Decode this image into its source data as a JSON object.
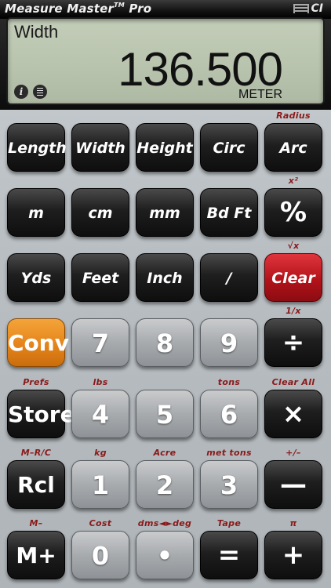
{
  "app": {
    "title_main": "Measure Master",
    "title_tm": "TM",
    "title_suffix": "Pro",
    "logo_text": "CI"
  },
  "display": {
    "label": "Width",
    "value": "136.500",
    "unit": "METER",
    "icons": [
      "info-icon",
      "tape-record-icon"
    ]
  },
  "colors": {
    "lcd_bg": "#b8c3ad",
    "secondary_label": "#8a1a1a",
    "clear_key": "#b3121a",
    "conv_key": "#e5841a"
  },
  "keys": [
    {
      "row": 0,
      "col": 0,
      "label": "Length",
      "style": "dark",
      "type": "it"
    },
    {
      "row": 0,
      "col": 1,
      "label": "Width",
      "style": "dark",
      "type": "it"
    },
    {
      "row": 0,
      "col": 2,
      "label": "Height",
      "style": "dark",
      "type": "it"
    },
    {
      "row": 0,
      "col": 3,
      "label": "Circ",
      "style": "dark",
      "type": "it"
    },
    {
      "row": 0,
      "col": 4,
      "label": "Arc",
      "style": "dark",
      "type": "it",
      "secondary": "Radius"
    },
    {
      "row": 1,
      "col": 0,
      "label": "m",
      "style": "dark",
      "type": "it"
    },
    {
      "row": 1,
      "col": 1,
      "label": "cm",
      "style": "dark",
      "type": "it"
    },
    {
      "row": 1,
      "col": 2,
      "label": "mm",
      "style": "dark",
      "type": "it"
    },
    {
      "row": 1,
      "col": 3,
      "label": "Bd Ft",
      "style": "dark",
      "type": "it"
    },
    {
      "row": 1,
      "col": 4,
      "label": "%",
      "style": "dark",
      "type": "op",
      "secondary": "x²"
    },
    {
      "row": 2,
      "col": 0,
      "label": "Yds",
      "style": "dark",
      "type": "it"
    },
    {
      "row": 2,
      "col": 1,
      "label": "Feet",
      "style": "dark",
      "type": "it"
    },
    {
      "row": 2,
      "col": 2,
      "label": "Inch",
      "style": "dark",
      "type": "it"
    },
    {
      "row": 2,
      "col": 3,
      "label": "/",
      "style": "dark",
      "type": "it"
    },
    {
      "row": 2,
      "col": 4,
      "label": "Clear",
      "style": "red",
      "type": "it",
      "secondary": "√x"
    },
    {
      "row": 3,
      "col": 0,
      "label": "Conv",
      "style": "orange",
      "type": "big"
    },
    {
      "row": 3,
      "col": 1,
      "label": "7",
      "style": "gray",
      "type": "num"
    },
    {
      "row": 3,
      "col": 2,
      "label": "8",
      "style": "gray",
      "type": "num"
    },
    {
      "row": 3,
      "col": 3,
      "label": "9",
      "style": "gray",
      "type": "num"
    },
    {
      "row": 3,
      "col": 4,
      "label": "÷",
      "style": "dark",
      "type": "op",
      "secondary": "1/x"
    },
    {
      "row": 4,
      "col": 0,
      "label": "Store",
      "style": "dark",
      "type": "big",
      "secondary": "Prefs"
    },
    {
      "row": 4,
      "col": 1,
      "label": "4",
      "style": "gray",
      "type": "num",
      "secondary": "lbs"
    },
    {
      "row": 4,
      "col": 2,
      "label": "5",
      "style": "gray",
      "type": "num"
    },
    {
      "row": 4,
      "col": 3,
      "label": "6",
      "style": "gray",
      "type": "num",
      "secondary": "tons"
    },
    {
      "row": 4,
      "col": 4,
      "label": "×",
      "style": "dark",
      "type": "op",
      "secondary": "Clear All"
    },
    {
      "row": 5,
      "col": 0,
      "label": "Rcl",
      "style": "dark",
      "type": "big",
      "secondary": "M–R/C"
    },
    {
      "row": 5,
      "col": 1,
      "label": "1",
      "style": "gray",
      "type": "num",
      "secondary": "kg"
    },
    {
      "row": 5,
      "col": 2,
      "label": "2",
      "style": "gray",
      "type": "num",
      "secondary": "Acre"
    },
    {
      "row": 5,
      "col": 3,
      "label": "3",
      "style": "gray",
      "type": "num",
      "secondary": "met tons"
    },
    {
      "row": 5,
      "col": 4,
      "label": "—",
      "style": "dark",
      "type": "op",
      "secondary": "+/–"
    },
    {
      "row": 6,
      "col": 0,
      "label": "M+",
      "style": "dark",
      "type": "big",
      "secondary": "M–"
    },
    {
      "row": 6,
      "col": 1,
      "label": "0",
      "style": "gray",
      "type": "num",
      "secondary": "Cost"
    },
    {
      "row": 6,
      "col": 2,
      "label": "•",
      "style": "gray",
      "type": "num",
      "secondary": "dms◄►deg"
    },
    {
      "row": 6,
      "col": 3,
      "label": "=",
      "style": "dark",
      "type": "op",
      "secondary": "Tape"
    },
    {
      "row": 6,
      "col": 4,
      "label": "+",
      "style": "dark",
      "type": "op",
      "secondary": "π"
    }
  ]
}
